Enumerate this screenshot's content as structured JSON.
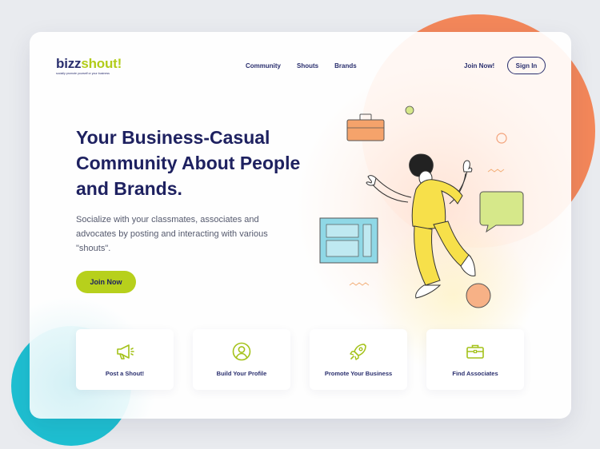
{
  "brand": {
    "name_part1": "b",
    "name_part2": "i",
    "name_part3": "zz",
    "name_part4": "shout!",
    "tagline": "socially promote yourself or your business",
    "accent_color": "#b7d01c",
    "primary_color": "#1e2160"
  },
  "nav": {
    "items": [
      {
        "label": "Community"
      },
      {
        "label": "Shouts"
      },
      {
        "label": "Brands"
      }
    ],
    "join_label": "Join Now!",
    "signin_label": "Sign In"
  },
  "hero": {
    "title": "Your Business-Casual Community About People and Brands.",
    "subtitle": "Socialize with your classmates, associates and advocates by posting and interacting with various \"shouts\".",
    "cta_label": "Join Now"
  },
  "features": [
    {
      "label": "Post a Shout!",
      "icon": "megaphone-icon"
    },
    {
      "label": "Build Your Profile",
      "icon": "user-profile-icon"
    },
    {
      "label": "Promote Your Business",
      "icon": "rocket-icon"
    },
    {
      "label": "Find Associates",
      "icon": "briefcase-icon"
    }
  ],
  "decor_colors": {
    "orange_blob": "#f3875a",
    "teal_blob": "#1ec0d2"
  }
}
